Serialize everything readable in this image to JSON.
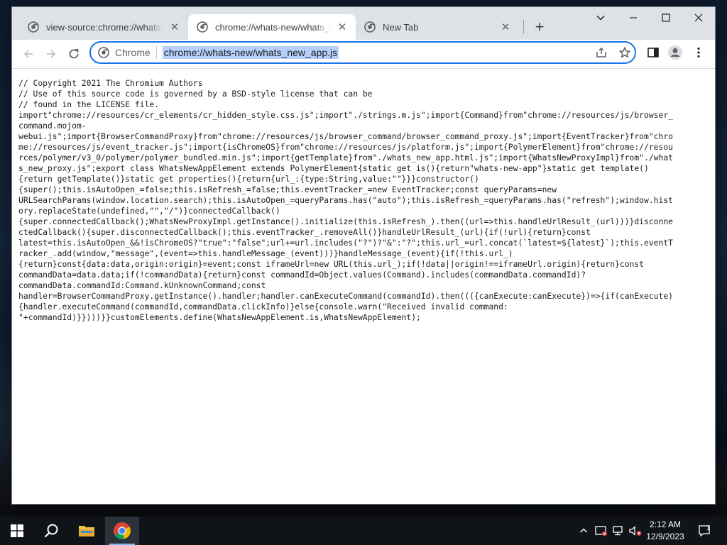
{
  "browser": {
    "tabs": [
      {
        "title": "view-source:chrome://whats-new/whats_new_app.js",
        "active": false
      },
      {
        "title": "chrome://whats-new/whats_new_app.js",
        "active": true
      },
      {
        "title": "New Tab",
        "active": false
      }
    ],
    "new_tab_label": "+",
    "omnibox": {
      "chip_label": "Chrome",
      "url": "chrome://whats-new/whats_new_app.js"
    }
  },
  "page": {
    "lines": [
      "// Copyright 2021 The Chromium Authors",
      "// Use of this source code is governed by a BSD-style license that can be",
      "// found in the LICENSE file.",
      "import\"chrome://resources/cr_elements/cr_hidden_style.css.js\";import\"./strings.m.js\";import{Command}from\"chrome://resources/js/browser_",
      "command.mojom-",
      "webui.js\";import{BrowserCommandProxy}from\"chrome://resources/js/browser_command/browser_command_proxy.js\";import{EventTracker}from\"chro",
      "me://resources/js/event_tracker.js\";import{isChromeOS}from\"chrome://resources/js/platform.js\";import{PolymerElement}from\"chrome://resou",
      "rces/polymer/v3_0/polymer/polymer_bundled.min.js\";import{getTemplate}from\"./whats_new_app.html.js\";import{WhatsNewProxyImpl}from\"./what",
      "s_new_proxy.js\";export class WhatsNewAppElement extends PolymerElement{static get is(){return\"whats-new-app\"}static get template()",
      "{return getTemplate()}static get properties(){return{url_:{type:String,value:\"\"}}}constructor()",
      "{super();this.isAutoOpen_=false;this.isRefresh_=false;this.eventTracker_=new EventTracker;const queryParams=new",
      "URLSearchParams(window.location.search);this.isAutoOpen_=queryParams.has(\"auto\");this.isRefresh_=queryParams.has(\"refresh\");window.hist",
      "ory.replaceState(undefined,\"\",\"/\")}connectedCallback()",
      "{super.connectedCallback();WhatsNewProxyImpl.getInstance().initialize(this.isRefresh_).then((url=>this.handleUrlResult_(url)))}disconne",
      "ctedCallback(){super.disconnectedCallback();this.eventTracker_.removeAll()}handleUrlResult_(url){if(!url){return}const",
      "latest=this.isAutoOpen_&&!isChromeOS?\"true\":\"false\";url+=url.includes(\"?\")?\"&\":\"?\";this.url_=url.concat(`latest=${latest}`);this.eventT",
      "racker_.add(window,\"message\",(event=>this.handleMessage_(event)))}handleMessage_(event){if(!this.url_)",
      "{return}const{data:data,origin:origin}=event;const iframeUrl=new URL(this.url_);if(!data||origin!==iframeUrl.origin){return}const",
      "commandData=data.data;if(!commandData){return}const commandId=Object.values(Command).includes(commandData.commandId)?",
      "commandData.commandId:Command.kUnknownCommand;const",
      "handler=BrowserCommandProxy.getInstance().handler;handler.canExecuteCommand(commandId).then((({canExecute:canExecute})=>{if(canExecute)",
      "{handler.executeCommand(commandId,commandData.clickInfo)}else{console.warn(\"Received invalid command:",
      "\"+commandId)}})))}}customElements.define(WhatsNewAppElement.is,WhatsNewAppElement);"
    ]
  },
  "taskbar": {
    "clock_time": "2:12 AM",
    "clock_date": "12/9/2023",
    "notification_count": "1"
  },
  "icons": {
    "tab_favicon": "chrome-icon",
    "back": "arrow-left-icon",
    "forward": "arrow-right-icon",
    "reload": "reload-icon",
    "share": "share-icon",
    "bookmark": "star-icon",
    "side_panel": "side-panel-icon",
    "profile": "profile-icon",
    "menu": "kebab-menu-icon"
  },
  "colors": {
    "accent": "#1a73e8",
    "selection": "#b5d1fb",
    "tabstrip": "#dee1e6"
  }
}
